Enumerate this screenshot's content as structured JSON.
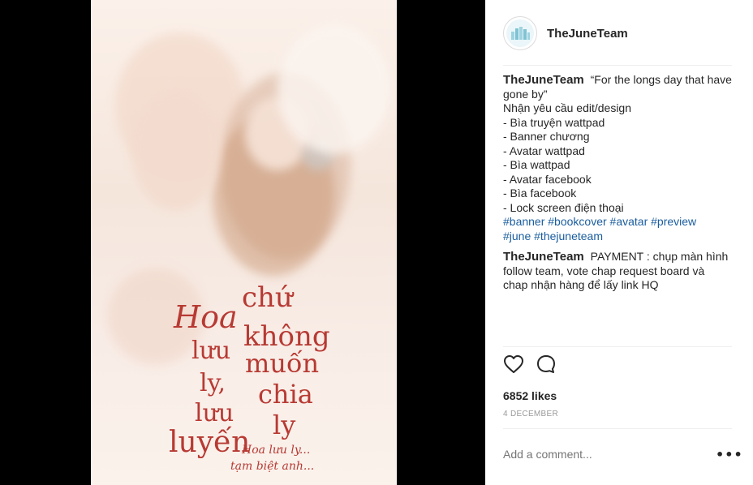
{
  "post": {
    "username": "TheJuneTeam",
    "caption_lines": [
      "“For the longs day that have gone by”",
      "Nhận yêu cầu edit/design",
      "- Bìa truyện wattpad",
      "- Banner chương",
      "- Avatar wattpad",
      "- Bìa wattpad",
      "- Avatar facebook",
      "- Bìa facebook",
      "- Lock screen điện thoại"
    ],
    "hashtags_line1": "#banner #bookcover #avatar #preview",
    "hashtags_line2": "#june #thejuneteam",
    "second_comment": {
      "username": "TheJuneTeam",
      "text": "PAYMENT : chụp màn hình follow team, vote chap request board và chap nhận hàng để lấy link HQ"
    },
    "likes": "6852 likes",
    "date": "4 DECEMBER",
    "add_comment_placeholder": "Add a comment...",
    "more_label": "•••"
  },
  "poster": {
    "title_left_1": "Hoa",
    "title_left_2": "lưu",
    "title_left_3": "ly,",
    "title_left_4": "lưu",
    "title_left_5": "luyến",
    "title_right_1": "chứ",
    "title_right_2": "không",
    "title_right_3": "muốn",
    "title_right_4": "chia",
    "title_right_5": "ly",
    "subtitle_1": "Hoa lưu ly...",
    "subtitle_2": "tạm biệt anh..."
  },
  "icons": {
    "like": "heart-outline-icon",
    "comment": "speech-bubble-icon"
  }
}
